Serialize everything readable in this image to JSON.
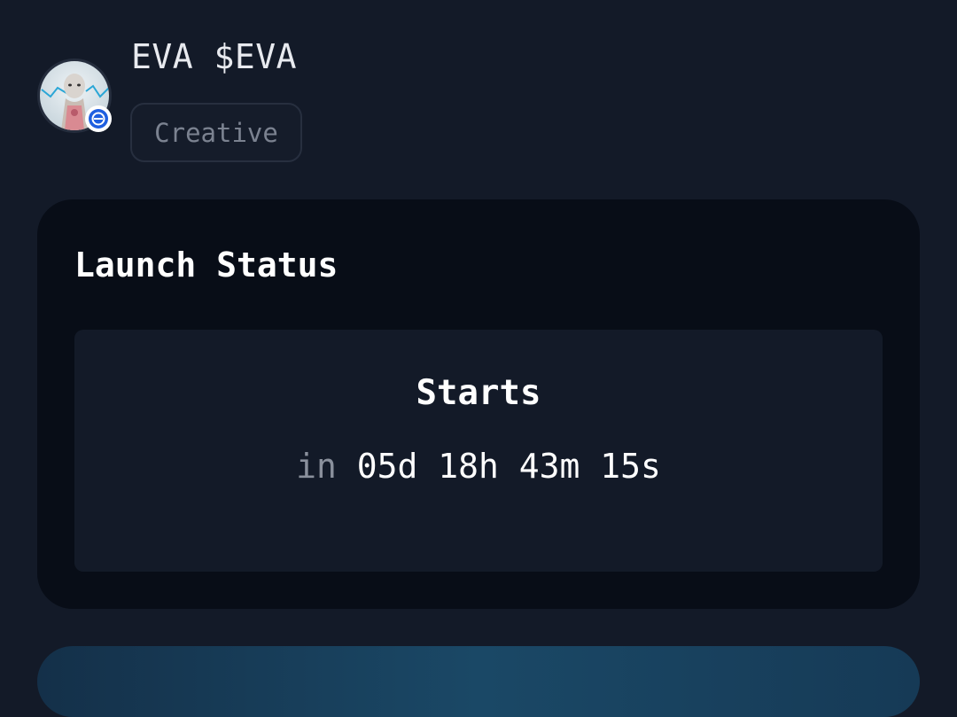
{
  "token": {
    "name_line": "EVA $EVA",
    "avatar_icon": "robot-avatar-icon",
    "chain_icon": "base-chain-icon",
    "category": "Creative"
  },
  "launch": {
    "heading": "Launch Status",
    "status_label": "Starts",
    "countdown_prefix": "in",
    "countdown_value": "05d 18h 43m 15s"
  },
  "colors": {
    "background": "#131a28",
    "card": "#080d17",
    "chain_badge": "#1f5fe0",
    "muted_text": "#8a909c"
  }
}
